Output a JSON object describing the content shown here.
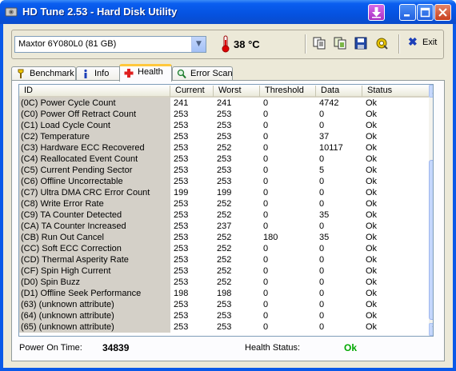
{
  "window": {
    "title": "HD Tune 2.53 - Hard Disk Utility"
  },
  "toolbar": {
    "drive": "Maxtor 6Y080L0 (81 GB)",
    "temperature": "38 °C",
    "exit_label": "Exit"
  },
  "tabs": [
    {
      "label": "Benchmark",
      "icon": "benchmark-icon"
    },
    {
      "label": "Info",
      "icon": "info-icon"
    },
    {
      "label": "Health",
      "icon": "health-cross-icon",
      "active": true
    },
    {
      "label": "Error Scan",
      "icon": "magnifier-icon"
    }
  ],
  "grid": {
    "columns": [
      "ID",
      "Current",
      "Worst",
      "Threshold",
      "Data",
      "Status"
    ],
    "rows": [
      {
        "id": "(0C) Power Cycle Count",
        "current": "241",
        "worst": "241",
        "threshold": "0",
        "data": "4742",
        "status": "Ok"
      },
      {
        "id": "(C0) Power Off Retract Count",
        "current": "253",
        "worst": "253",
        "threshold": "0",
        "data": "0",
        "status": "Ok"
      },
      {
        "id": "(C1) Load Cycle Count",
        "current": "253",
        "worst": "253",
        "threshold": "0",
        "data": "0",
        "status": "Ok"
      },
      {
        "id": "(C2) Temperature",
        "current": "253",
        "worst": "253",
        "threshold": "0",
        "data": "37",
        "status": "Ok"
      },
      {
        "id": "(C3) Hardware ECC Recovered",
        "current": "253",
        "worst": "252",
        "threshold": "0",
        "data": "10117",
        "status": "Ok"
      },
      {
        "id": "(C4) Reallocated Event Count",
        "current": "253",
        "worst": "253",
        "threshold": "0",
        "data": "0",
        "status": "Ok"
      },
      {
        "id": "(C5) Current Pending Sector",
        "current": "253",
        "worst": "253",
        "threshold": "0",
        "data": "5",
        "status": "Ok"
      },
      {
        "id": "(C6) Offline Uncorrectable",
        "current": "253",
        "worst": "253",
        "threshold": "0",
        "data": "0",
        "status": "Ok"
      },
      {
        "id": "(C7) Ultra DMA CRC Error Count",
        "current": "199",
        "worst": "199",
        "threshold": "0",
        "data": "0",
        "status": "Ok"
      },
      {
        "id": "(C8) Write Error Rate",
        "current": "253",
        "worst": "252",
        "threshold": "0",
        "data": "0",
        "status": "Ok"
      },
      {
        "id": "(C9) TA Counter Detected",
        "current": "253",
        "worst": "252",
        "threshold": "0",
        "data": "35",
        "status": "Ok"
      },
      {
        "id": "(CA) TA Counter Increased",
        "current": "253",
        "worst": "237",
        "threshold": "0",
        "data": "0",
        "status": "Ok"
      },
      {
        "id": "(CB) Run Out Cancel",
        "current": "253",
        "worst": "252",
        "threshold": "180",
        "data": "35",
        "status": "Ok"
      },
      {
        "id": "(CC) Soft ECC Correction",
        "current": "253",
        "worst": "252",
        "threshold": "0",
        "data": "0",
        "status": "Ok"
      },
      {
        "id": "(CD) Thermal Asperity Rate",
        "current": "253",
        "worst": "252",
        "threshold": "0",
        "data": "0",
        "status": "Ok"
      },
      {
        "id": "(CF) Spin High Current",
        "current": "253",
        "worst": "252",
        "threshold": "0",
        "data": "0",
        "status": "Ok"
      },
      {
        "id": "(D0) Spin Buzz",
        "current": "253",
        "worst": "252",
        "threshold": "0",
        "data": "0",
        "status": "Ok"
      },
      {
        "id": "(D1) Offline Seek Performance",
        "current": "198",
        "worst": "198",
        "threshold": "0",
        "data": "0",
        "status": "Ok"
      },
      {
        "id": "(63) (unknown attribute)",
        "current": "253",
        "worst": "253",
        "threshold": "0",
        "data": "0",
        "status": "Ok"
      },
      {
        "id": "(64) (unknown attribute)",
        "current": "253",
        "worst": "253",
        "threshold": "0",
        "data": "0",
        "status": "Ok"
      },
      {
        "id": "(65) (unknown attribute)",
        "current": "253",
        "worst": "253",
        "threshold": "0",
        "data": "0",
        "status": "Ok"
      }
    ]
  },
  "status": {
    "power_on_label": "Power On Time:",
    "power_on_value": "34839",
    "health_label": "Health Status:",
    "health_value": "Ok",
    "health_color": "#00a800"
  },
  "colors": {
    "title_bar": "#0552e0",
    "window_bg": "#ece9d8",
    "active_tab_accent": "#ffc83c"
  }
}
